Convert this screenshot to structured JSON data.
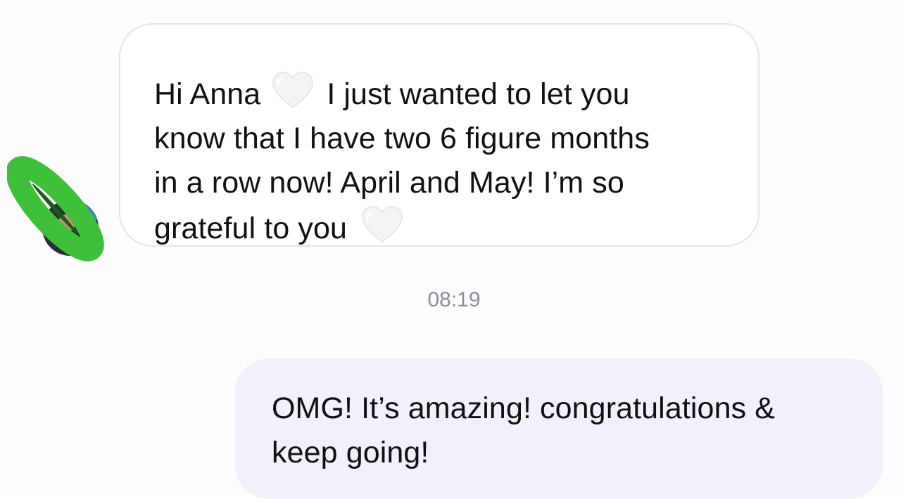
{
  "thread": {
    "incoming": {
      "lines": [
        {
          "before": "Hi Anna",
          "emoji": "white-heart",
          "after": "I just wanted to let you"
        },
        {
          "text": "know that I have two 6 figure months"
        },
        {
          "text": "in a row now! April and May! I’m so"
        },
        {
          "before": "grateful to you",
          "emoji": "white-heart"
        }
      ]
    },
    "timestamp": "08:19",
    "outgoing": {
      "lines": [
        "OMG! It’s amazing! congratulations &",
        "keep going!"
      ]
    }
  },
  "icons": {
    "avatar": "contact-avatar-redacted",
    "heart": "white-heart-emoji"
  },
  "colors": {
    "incoming_bubble": "#ffffff",
    "incoming_border": "#e4e2f4",
    "outgoing_bubble": "#f1f0fb",
    "timestamp_text": "#8e8e96",
    "redaction_mark": "#3fc03a"
  }
}
